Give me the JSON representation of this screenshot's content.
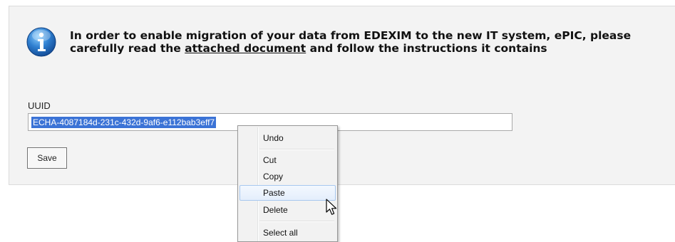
{
  "notice": {
    "icon": "info-icon",
    "line1": "In order to enable migration of your data from EDEXIM to the new IT system, ePIC, please",
    "line2_prefix": "carefully read the ",
    "link_text": "attached document",
    "line2_suffix": " and follow the instructions it contains"
  },
  "form": {
    "uuid_label": "UUID",
    "uuid_value": "ECHA-4087184d-231c-432d-9af6-e112bab3eff7",
    "save_label": "Save"
  },
  "context_menu": {
    "items": {
      "undo": "Undo",
      "cut": "Cut",
      "copy": "Copy",
      "paste": "Paste",
      "delete": "Delete",
      "select_all": "Select all"
    },
    "hovered": "Paste"
  },
  "colors": {
    "selection": "#3b73d6",
    "info_icon": "#2f7fd0",
    "panel": "#f3f3f3"
  }
}
